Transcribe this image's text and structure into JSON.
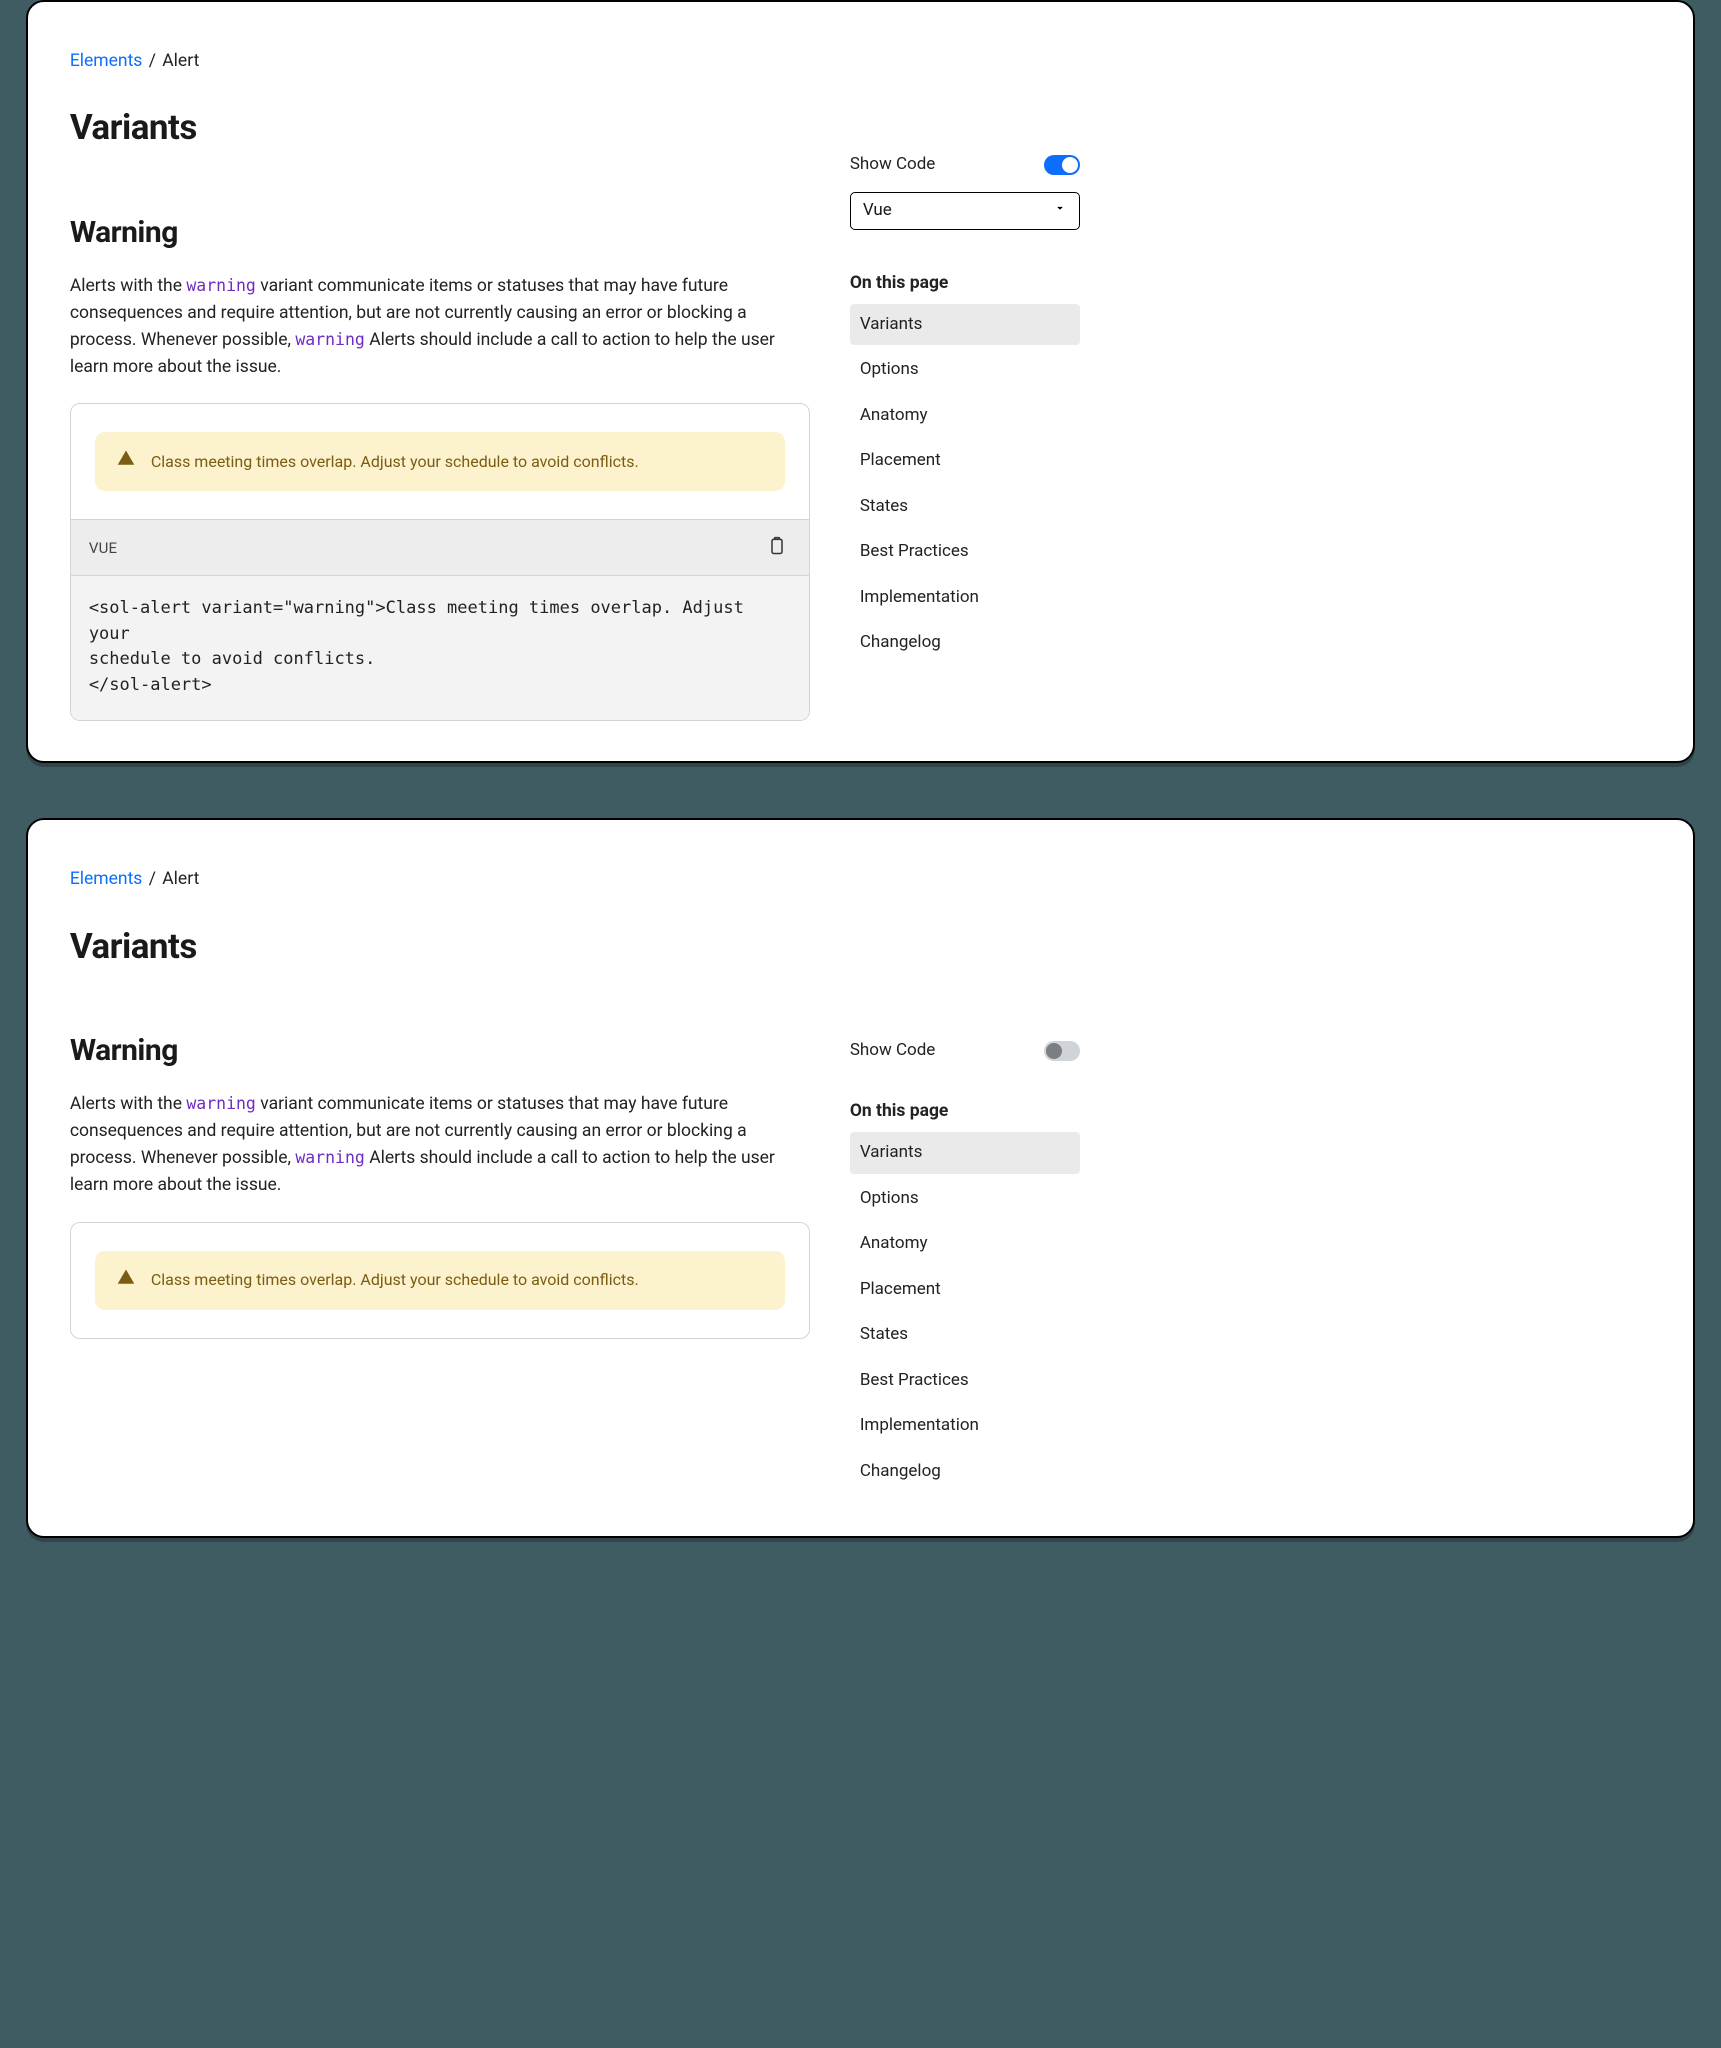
{
  "breadcrumb": {
    "root": "Elements",
    "current": "Alert"
  },
  "title": "Variants",
  "section": "Warning",
  "body": {
    "p1a": "Alerts with the ",
    "code1": "warning",
    "p1b": " variant communicate items or statuses that may have future consequences and require attention, but are not currently causing an error or blocking a process. Whenever possible, ",
    "code2": "warning",
    "p1c": " Alerts should include a call to action to help the user learn more about the issue."
  },
  "alert_text": "Class meeting times overlap. Adjust your schedule to avoid conflicts.",
  "code": {
    "lang_label": "VUE",
    "snippet": "<sol-alert variant=\"warning\">Class meeting times overlap. Adjust your\nschedule to avoid conflicts.\n</sol-alert>"
  },
  "sidebar": {
    "show_code_label": "Show Code",
    "framework": "Vue",
    "toc_title": "On this page",
    "toc": [
      "Variants",
      "Options",
      "Anatomy",
      "Placement",
      "States",
      "Best Practices",
      "Implementation",
      "Changelog"
    ],
    "toc_active": "Variants"
  }
}
